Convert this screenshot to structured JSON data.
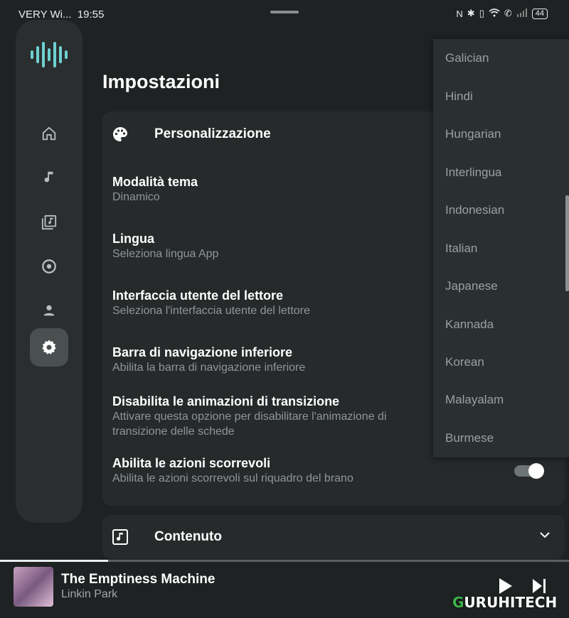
{
  "status_bar": {
    "carrier": "VERY Wi...",
    "time": "19:55",
    "battery": "44"
  },
  "colors": {
    "accent": "#6fd0d0",
    "background": "#1e2222",
    "surface": "#262a2a",
    "watermark_green": "#3cb44a"
  },
  "nav_rail": {
    "logo_icon": "waveform-icon",
    "items": [
      {
        "icon": "home-icon"
      },
      {
        "icon": "music-note-icon"
      },
      {
        "icon": "library-icon"
      },
      {
        "icon": "album-icon"
      },
      {
        "icon": "person-icon"
      },
      {
        "icon": "settings-icon",
        "active": true
      }
    ]
  },
  "page": {
    "title": "Impostazioni"
  },
  "personalization": {
    "header": "Personalizzazione",
    "icon": "palette-icon",
    "settings": [
      {
        "title": "Modalità tema",
        "subtitle": "Dinamico"
      },
      {
        "title": "Lingua",
        "subtitle": "Seleziona lingua App"
      },
      {
        "title": "Interfaccia utente del lettore",
        "subtitle": "Seleziona l'interfaccia utente del lettore"
      },
      {
        "title": "Barra di navigazione inferiore",
        "subtitle": "Abilita la barra di navigazione inferiore"
      },
      {
        "title": "Disabilita le animazioni di transizione",
        "subtitle_line1": "Attivare questa opzione per disabilitare l'animazione di",
        "subtitle_line2": "transizione delle schede"
      },
      {
        "title": "Abilita le azioni scorrevoli",
        "subtitle": "Abilita le azioni scorrevoli sul riquadro del brano",
        "toggle_on": true
      }
    ]
  },
  "content_section": {
    "header": "Contenuto",
    "icon": "music-file-icon"
  },
  "language_dropdown": {
    "options": [
      "Galician",
      "Hindi",
      "Hungarian",
      "Interlingua",
      "Indonesian",
      "Italian",
      "Japanese",
      "Kannada",
      "Korean",
      "Malayalam",
      "Burmese"
    ]
  },
  "player": {
    "song": "The Emptiness Machine",
    "artist": "Linkin Park",
    "progress": 0.19
  },
  "watermark": {
    "prefix": "G",
    "text": "URUHITECH"
  }
}
